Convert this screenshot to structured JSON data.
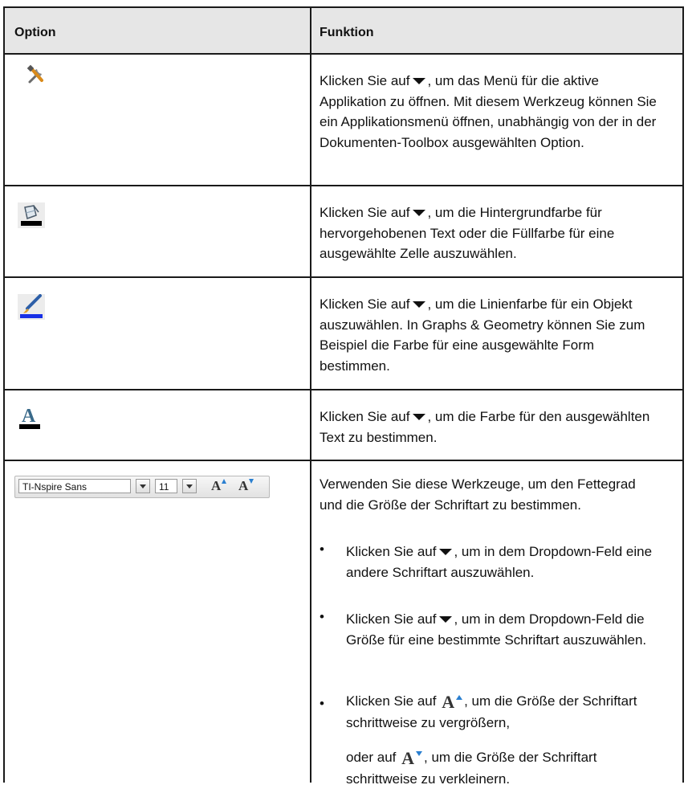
{
  "header": {
    "option": "Option",
    "function": "Funktion"
  },
  "rows": [
    {
      "icon": "tools-icon",
      "parts": [
        "Klicken Sie auf",
        ", um das Menü für die aktive Applikation zu öffnen. Mit diesem Werkzeug können Sie ein Applikationsmenü öffnen, unabhängig von der in der Dokumenten-Toolbox ausgewählten Option."
      ]
    },
    {
      "icon": "fill-bucket-icon",
      "parts": [
        "Klicken Sie auf",
        ", um die Hintergrundfarbe für hervorgehobenen Text oder die Füllfarbe für eine ausgewählte Zelle auszuwählen."
      ]
    },
    {
      "icon": "line-color-brush-icon",
      "parts": [
        "Klicken Sie auf",
        ", um die Linienfarbe für ein Objekt auszuwählen. In Graphs & Geometry können Sie zum Beispiel die Farbe für eine ausgewählte Form bestimmen."
      ]
    },
    {
      "icon": "text-color-icon",
      "parts": [
        "Klicken Sie auf",
        ", um die Farbe für den ausgewählten Text zu bestimmen."
      ]
    }
  ],
  "font_row": {
    "toolbar": {
      "font_value": "TI-Nspire Sans",
      "size_value": "11",
      "increase_glyph": "A",
      "decrease_glyph": "A"
    },
    "intro": "Verwenden Sie diese Werkzeuge, um den Fettegrad und die Größe der Schriftart zu bestimmen.",
    "bullet_symbol": "•",
    "bullet1": [
      "Klicken Sie auf",
      ", um in dem Dropdown-Feld eine andere Schriftart auszuwählen."
    ],
    "bullet2": [
      "Klicken Sie auf",
      ", um in dem Dropdown-Feld die Größe für eine bestimmte Schriftart auszuwählen."
    ],
    "bullet3a": [
      "Klicken Sie auf",
      ", um die Größe der Schriftart schrittweise zu vergrößern,"
    ],
    "bullet3b": [
      "oder auf",
      ", um die Größe der Schriftart schrittweise zu verkleinern."
    ],
    "inline_glyph": "A"
  }
}
